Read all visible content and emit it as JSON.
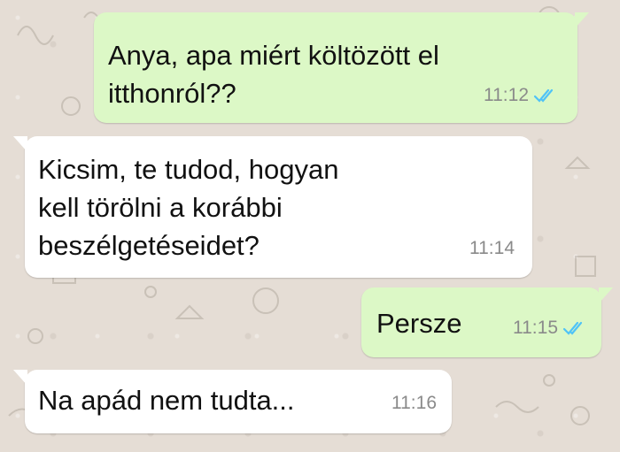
{
  "chat": {
    "messages": [
      {
        "text_lines": [
          "Anya, apa miért költözött el",
          "itthonról??"
        ],
        "time": "11:12",
        "status": "read-double-check-icon"
      },
      {
        "text_lines": [
          "Kicsim, te tudod, hogyan",
          "kell törölni a korábbi",
          "beszélgetéseidet?"
        ],
        "time": "11:14"
      },
      {
        "text_lines": [
          "Persze"
        ],
        "time": "11:15",
        "status": "read-double-check-icon"
      },
      {
        "text_lines": [
          "Na apád nem tudta..."
        ],
        "time": "11:16"
      }
    ]
  },
  "colors": {
    "outgoing_bubble": "#dcf8c6",
    "incoming_bubble": "#ffffff",
    "wallpaper": "#e5ddd5",
    "read_ticks": "#4fc3f7",
    "timestamp": "#8a8a8a"
  }
}
